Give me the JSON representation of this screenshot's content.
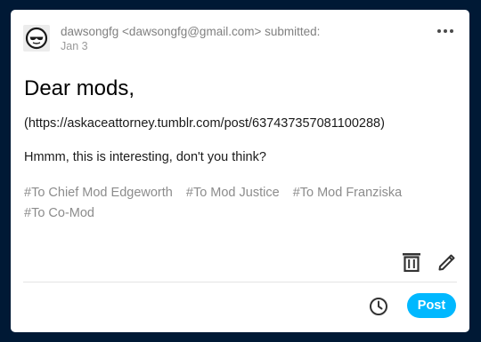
{
  "submission": {
    "submitter_line": "dawsongfg <dawsongfg@gmail.com> submitted:",
    "date": "Jan 3",
    "title": "Dear mods,",
    "link": "(https://askaceattorney.tumblr.com/post/637437357081100288)",
    "body": "Hmmm, this is interesting, don't you think?",
    "tags": [
      "#To Chief Mod Edgeworth",
      "#To Mod Justice",
      "#To Mod Franziska",
      "#To Co-Mod"
    ]
  },
  "actions": {
    "post_label": "Post"
  },
  "icons": {
    "avatar": "sunglasses-avatar-icon",
    "more": "more-options-icon",
    "delete": "trash-icon",
    "edit": "pencil-icon",
    "schedule": "clock-icon"
  },
  "colors": {
    "page_background": "#001935",
    "card_background": "#ffffff",
    "post_button": "#00b8ff",
    "tag_text": "#8c8c8c",
    "meta_text": "#808080"
  }
}
